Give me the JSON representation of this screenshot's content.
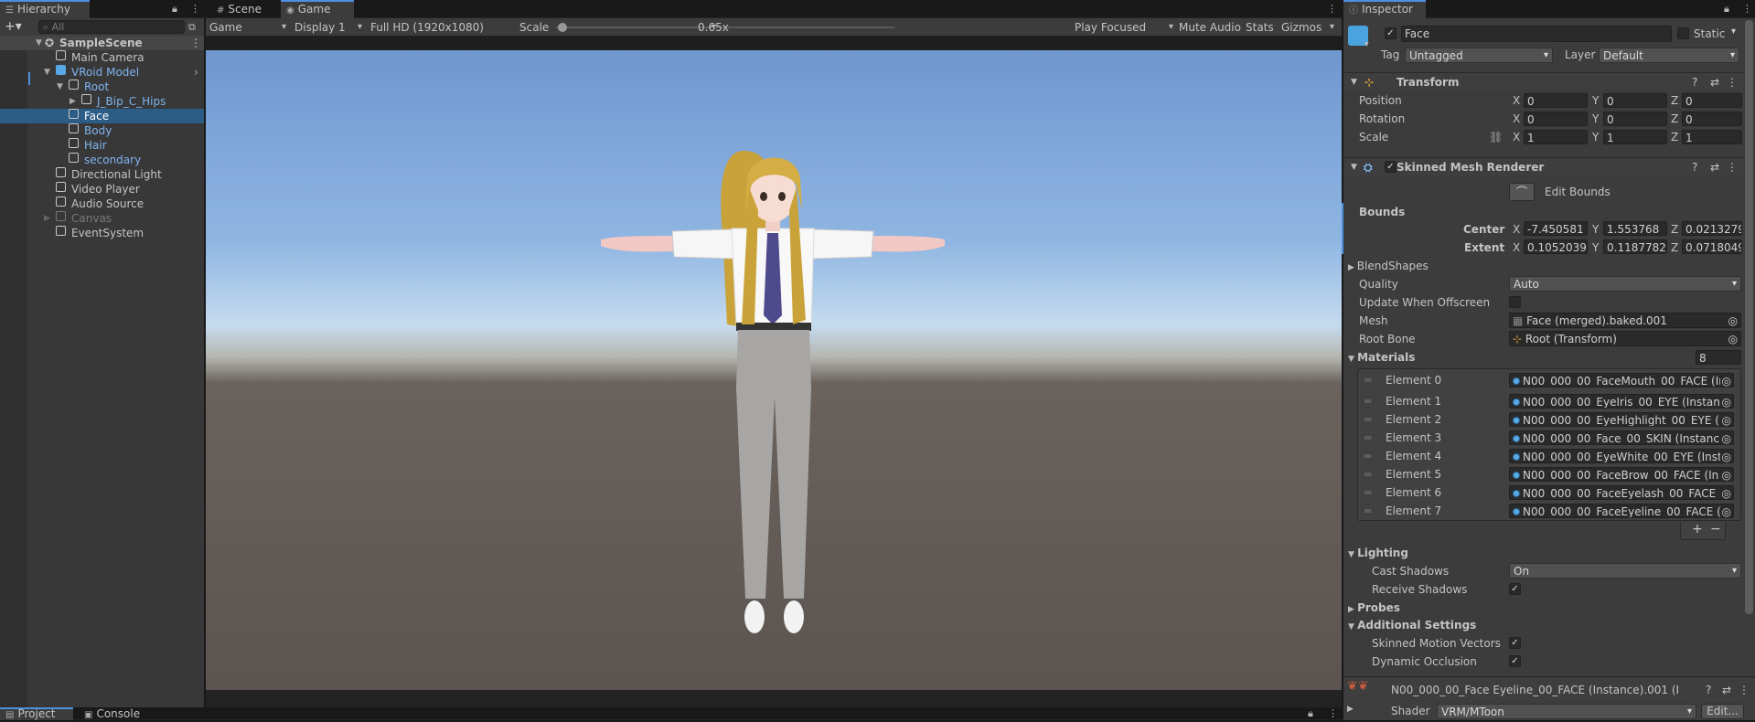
{
  "hierarchy": {
    "tab_label": "Hierarchy",
    "search_placeholder": "All",
    "add_label": "+▾",
    "items": [
      {
        "label": "SampleScene"
      },
      {
        "label": "Main Camera"
      },
      {
        "label": "VRoid Model"
      },
      {
        "label": "Root"
      },
      {
        "label": "J_Bip_C_Hips"
      },
      {
        "label": "Face"
      },
      {
        "label": "Body"
      },
      {
        "label": "Hair"
      },
      {
        "label": "secondary"
      },
      {
        "label": "Directional Light"
      },
      {
        "label": "Video Player"
      },
      {
        "label": "Audio Source"
      },
      {
        "label": "Canvas"
      },
      {
        "label": "EventSystem"
      }
    ]
  },
  "center": {
    "tabs": [
      {
        "label": "Scene"
      },
      {
        "label": "Game"
      }
    ],
    "toolbar": {
      "view": "Game",
      "display": "Display 1",
      "resolution": "Full HD (1920x1080)",
      "scale_label": "Scale",
      "scale_value": "0.65x",
      "scale_fraction": 0.02,
      "play_mode": "Play Focused",
      "mute": "Mute Audio",
      "stats": "Stats",
      "gizmos": "Gizmos"
    }
  },
  "bottom_tabs": [
    {
      "label": "Project"
    },
    {
      "label": "Console"
    }
  ],
  "inspector": {
    "tab_label": "Inspector",
    "object_name": "Face",
    "static_label": "Static",
    "tag_label": "Tag",
    "tag_value": "Untagged",
    "layer_label": "Layer",
    "layer_value": "Default",
    "transform": {
      "title": "Transform",
      "rows": [
        {
          "label": "Position",
          "x": "0",
          "y": "0",
          "z": "0"
        },
        {
          "label": "Rotation",
          "x": "0",
          "y": "0",
          "z": "0"
        },
        {
          "label": "Scale",
          "x": "1",
          "y": "1",
          "z": "1"
        }
      ],
      "axis_x": "X",
      "axis_y": "Y",
      "axis_z": "Z"
    },
    "smr": {
      "title": "Skinned Mesh Renderer",
      "edit_bounds": "Edit Bounds",
      "bounds_label": "Bounds",
      "center_label": "Center",
      "center": {
        "x": "-7.450581",
        "y": "1.553768",
        "z": "0.0213279"
      },
      "extent_label": "Extent",
      "extent": {
        "x": "0.1052039",
        "y": "0.1187782",
        "z": "0.0718049"
      },
      "blendshapes": "BlendShapes",
      "quality_label": "Quality",
      "quality_value": "Auto",
      "update_offscreen": "Update When Offscreen",
      "mesh_label": "Mesh",
      "mesh_value": "Face (merged).baked.001",
      "root_bone_label": "Root Bone",
      "root_bone_value": "Root (Transform)",
      "materials_label": "Materials",
      "materials_count": "8",
      "elements": [
        {
          "label": "Element 0",
          "value": "N00_000_00_FaceMouth_00_FACE (Ir"
        },
        {
          "label": "Element 1",
          "value": "N00_000_00_EyeIris_00_EYE (Instanc"
        },
        {
          "label": "Element 2",
          "value": "N00_000_00_EyeHighlight_00_EYE (Ir"
        },
        {
          "label": "Element 3",
          "value": "N00_000_00_Face_00_SKIN (Instanc"
        },
        {
          "label": "Element 4",
          "value": "N00_000_00_EyeWhite_00_EYE (Insta"
        },
        {
          "label": "Element 5",
          "value": "N00_000_00_FaceBrow_00_FACE (In"
        },
        {
          "label": "Element 6",
          "value": "N00_000_00_FaceEyelash_00_FACE"
        },
        {
          "label": "Element 7",
          "value": "N00_000_00_FaceEyeline_00_FACE ("
        }
      ],
      "plus": "+",
      "minus": "−",
      "lighting": "Lighting",
      "cast_shadows_label": "Cast Shadows",
      "cast_shadows_value": "On",
      "receive_shadows_label": "Receive Shadows",
      "probes": "Probes",
      "additional": "Additional Settings",
      "motion_vectors": "Skinned Motion Vectors",
      "dynamic_occlusion": "Dynamic Occlusion"
    },
    "material": {
      "title": "N00_000_00_Face Eyeline_00_FACE (Instance).001 (I",
      "shader_label": "Shader",
      "shader_value": "VRM/MToon",
      "edit_label": "Edit..."
    }
  }
}
